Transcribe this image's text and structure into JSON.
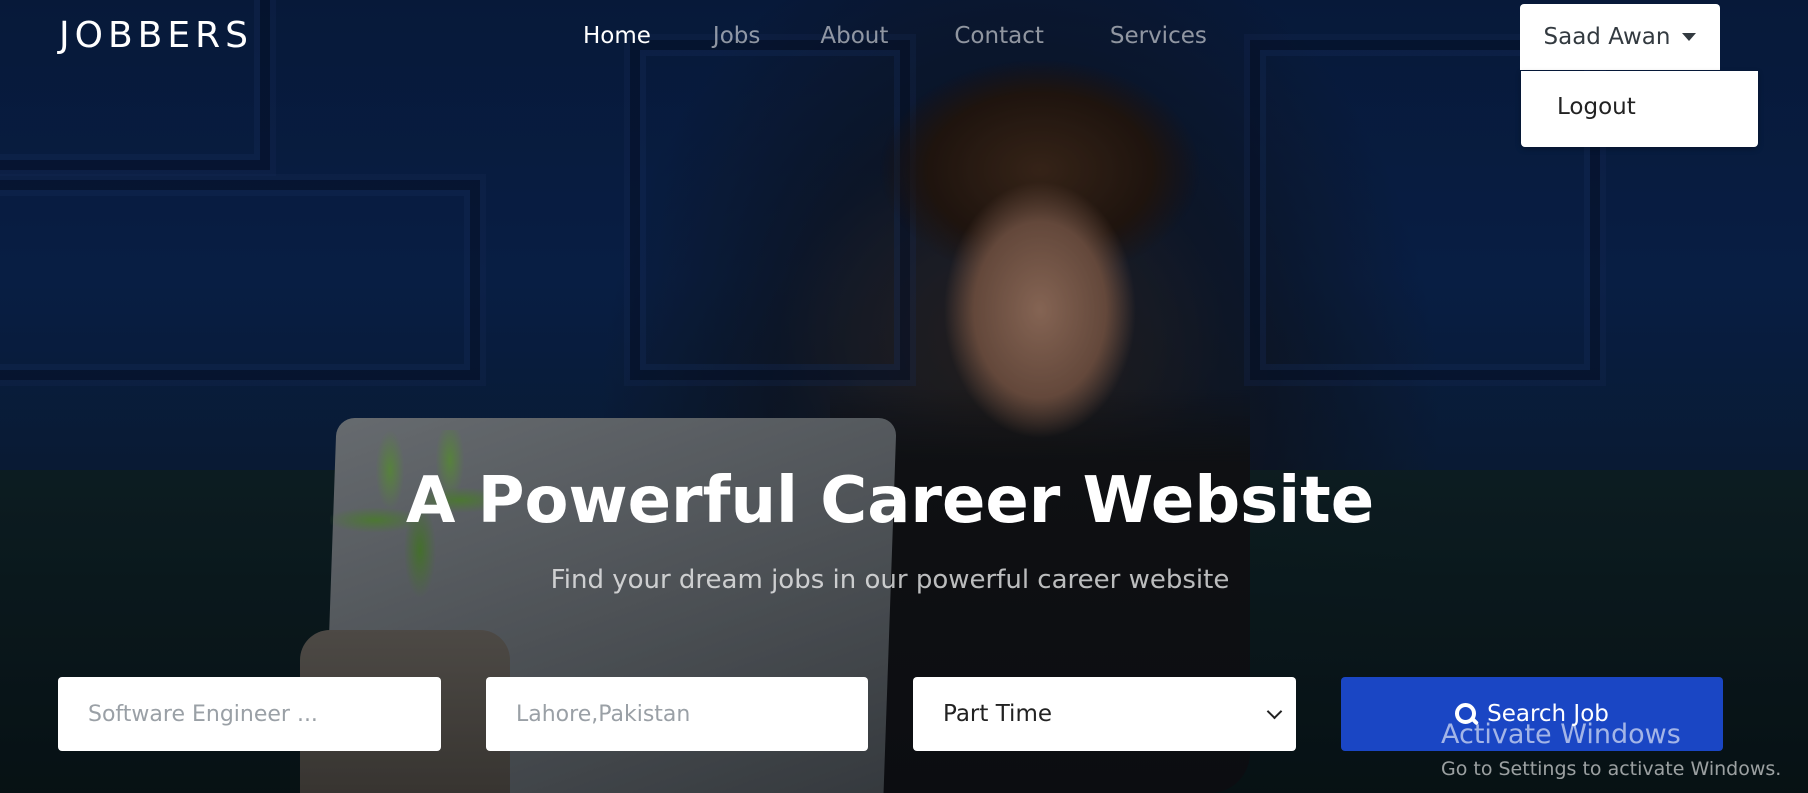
{
  "brand": "JOBBERS",
  "nav": {
    "items": [
      {
        "label": "Home",
        "active": true
      },
      {
        "label": "Jobs",
        "active": false
      },
      {
        "label": "About",
        "active": false
      },
      {
        "label": "Contact",
        "active": false
      },
      {
        "label": "Services",
        "active": false
      }
    ]
  },
  "user_menu": {
    "name": "Saad Awan",
    "items": [
      {
        "label": "Logout"
      }
    ]
  },
  "hero": {
    "title": "A Powerful Career Website",
    "subtitle": "Find your dream jobs in our powerful career website"
  },
  "search_form": {
    "keyword_placeholder": "Software Engineer ...",
    "location_placeholder": "Lahore,Pakistan",
    "job_type_selected": "Part Time",
    "submit_label": "Search Job",
    "submit_color": "#1a46c4"
  },
  "watermark": {
    "title": "Activate Windows",
    "subtitle": "Go to Settings to activate Windows."
  }
}
